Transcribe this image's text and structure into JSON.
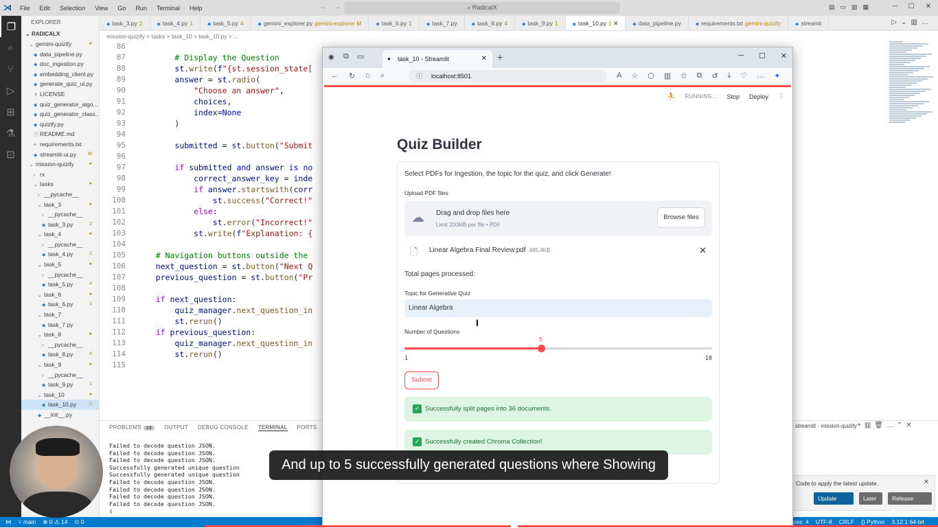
{
  "titlebar": {
    "menu": [
      "File",
      "Edit",
      "Selection",
      "View",
      "Go",
      "Run",
      "Terminal",
      "Help"
    ],
    "command_center": "RadicalX"
  },
  "explorer": {
    "header": "EXPLORER",
    "root": "RADICALX",
    "items": [
      {
        "label": "gemini-quizify",
        "level": 1,
        "type": "folder-open",
        "badge": "●"
      },
      {
        "label": "data_pipeline.py",
        "level": 2,
        "type": "py",
        "badge": ""
      },
      {
        "label": "doc_ingestion.py",
        "level": 2,
        "type": "py",
        "badge": ""
      },
      {
        "label": "embedding_client.py",
        "level": 2,
        "type": "py",
        "badge": ""
      },
      {
        "label": "generate_quiz_ui.py",
        "level": 2,
        "type": "py",
        "badge": ""
      },
      {
        "label": "LICENSE",
        "level": 2,
        "type": "file",
        "badge": ""
      },
      {
        "label": "quiz_generator_algo...",
        "level": 2,
        "type": "py",
        "badge": ""
      },
      {
        "label": "quiz_generator_class...",
        "level": 2,
        "type": "py",
        "badge": ""
      },
      {
        "label": "quizify.py",
        "level": 2,
        "type": "py",
        "badge": ""
      },
      {
        "label": "README.md",
        "level": 2,
        "type": "md",
        "badge": ""
      },
      {
        "label": "requirements.txt",
        "level": 2,
        "type": "txt",
        "badge": ""
      },
      {
        "label": "streamlit-ui.py",
        "level": 2,
        "type": "py",
        "badge": "M"
      },
      {
        "label": "mission-quizify",
        "level": 1,
        "type": "folder-open",
        "badge": "●"
      },
      {
        "label": "rx",
        "level": 2,
        "type": "folder",
        "badge": ""
      },
      {
        "label": "tasks",
        "level": 2,
        "type": "folder-open",
        "badge": "●"
      },
      {
        "label": "__pycache__",
        "level": 3,
        "type": "folder",
        "badge": ""
      },
      {
        "label": "task_3",
        "level": 3,
        "type": "folder-open",
        "badge": "●"
      },
      {
        "label": "__pycache__",
        "level": 4,
        "type": "folder",
        "badge": ""
      },
      {
        "label": "task_3.py",
        "level": 4,
        "type": "py",
        "badge": "2"
      },
      {
        "label": "task_4",
        "level": 3,
        "type": "folder-open",
        "badge": "●"
      },
      {
        "label": "__pycache__",
        "level": 4,
        "type": "folder",
        "badge": ""
      },
      {
        "label": "task_4.py",
        "level": 4,
        "type": "py",
        "badge": "1"
      },
      {
        "label": "task_5",
        "level": 3,
        "type": "folder-open",
        "badge": "●"
      },
      {
        "label": "__pycache__",
        "level": 4,
        "type": "folder",
        "badge": ""
      },
      {
        "label": "task_5.py",
        "level": 4,
        "type": "py",
        "badge": "4"
      },
      {
        "label": "task_6",
        "level": 3,
        "type": "folder-open",
        "badge": "●"
      },
      {
        "label": "task_6.py",
        "level": 4,
        "type": "py",
        "badge": "1"
      },
      {
        "label": "task_7",
        "level": 3,
        "type": "folder-open",
        "badge": ""
      },
      {
        "label": "task_7.py",
        "level": 4,
        "type": "py",
        "badge": ""
      },
      {
        "label": "task_8",
        "level": 3,
        "type": "folder-open",
        "badge": "●"
      },
      {
        "label": "__pycache__",
        "level": 4,
        "type": "folder",
        "badge": ""
      },
      {
        "label": "task_8.py",
        "level": 4,
        "type": "py",
        "badge": "4"
      },
      {
        "label": "task_9",
        "level": 3,
        "type": "folder-open",
        "badge": "●"
      },
      {
        "label": "__pycache__",
        "level": 4,
        "type": "folder",
        "badge": ""
      },
      {
        "label": "task_9.py",
        "level": 4,
        "type": "py",
        "badge": "1"
      },
      {
        "label": "task_10",
        "level": 3,
        "type": "folder-open",
        "badge": "●"
      },
      {
        "label": "task_10.py",
        "level": 4,
        "type": "py",
        "badge": "1",
        "selected": true
      },
      {
        "label": "__init__.py",
        "level": 3,
        "type": "py",
        "badge": ""
      }
    ]
  },
  "tabs": [
    {
      "label": "task_3.py",
      "badge": "2"
    },
    {
      "label": "task_4.py",
      "badge": "1"
    },
    {
      "label": "task_5.py",
      "badge": "4"
    },
    {
      "label": "gemini_explorer.py",
      "badge": "gemini-explorer M"
    },
    {
      "label": "task_6.py",
      "badge": "1"
    },
    {
      "label": "task_7.py",
      "badge": ""
    },
    {
      "label": "task_8.py",
      "badge": "4"
    },
    {
      "label": "task_9.py",
      "badge": "1"
    },
    {
      "label": "task_10.py",
      "badge": "1",
      "active": true
    },
    {
      "label": "data_pipeline.py",
      "badge": ""
    },
    {
      "label": "requirements.txt",
      "badge": "gemini-quizify"
    },
    {
      "label": "streamli",
      "badge": ""
    }
  ],
  "breadcrumb": "mission-quizify > tasks > task_10 > task_10.py > ...",
  "editor": {
    "line_numbers": [
      "86",
      "87",
      "88",
      "89",
      "90",
      "91",
      "92",
      "93",
      "94",
      "95",
      "96",
      "97",
      "98",
      "99",
      "100",
      "101",
      "102",
      "103",
      "104",
      "105",
      "106",
      "107",
      "108",
      "109",
      "110",
      "111",
      "112",
      "113",
      "114",
      "115"
    ]
  },
  "panel": {
    "tabs": [
      "PROBLEMS",
      "OUTPUT",
      "DEBUG CONSOLE",
      "TERMINAL",
      "PORTS"
    ],
    "problems_count": "14",
    "terminal_title": "streamlit - mission-quizify",
    "terminal_lines": [
      "Failed to decode question JSON.",
      "Failed to decode question JSON.",
      "Failed to decode question JSON.",
      "Successfully generated unique question",
      "Successfully generated unique question",
      "Failed to decode question JSON.",
      "Failed to decode question JSON.",
      "Failed to decode question JSON.",
      "Failed to decode question JSON."
    ]
  },
  "notification": {
    "text": "Code to apply the latest update.",
    "update_now": "Update Now",
    "later": "Later",
    "release_notes": "Release Notes"
  },
  "statusbar": {
    "branch": "main",
    "sync": "⊗ 0 ⚠ 14",
    "ports": "0",
    "spaces": "ces: 4",
    "encoding": "UTF-8",
    "eol": "CRLF",
    "language": "Python",
    "interpreter": "3.12.1 64-bit"
  },
  "browser": {
    "tab_title": "task_10 - Streamlit",
    "url": "localhost:8501"
  },
  "streamlit": {
    "status": "RUNNING...",
    "stop": "Stop",
    "deploy": "Deploy",
    "title": "Quiz Builder",
    "intro": "Select PDFs for Ingestion, the topic for the quiz, and click Generate!",
    "upload_label": "Upload PDF files",
    "drop_main": "Drag and drop files here",
    "drop_sub": "Limit 200MB per file • PDF",
    "browse": "Browse files",
    "file_name": "Linear Algebra Final Review.pdf",
    "file_size": "485.4KB",
    "pages_text": "Total pages processed:",
    "topic_label": "Topic for Generative Quiz",
    "topic_value": "Linear Algebra",
    "num_label": "Number of Questions",
    "slider_min": "1",
    "slider_max": "10",
    "slider_value": 5,
    "submit": "Submit",
    "success1": "Successfully split pages into 36 documents.",
    "success2": "Successfully created Chroma Collection!"
  },
  "caption": "And up to 5 successfully generated questions where Showing",
  "colors": {
    "accent": "#ff4b4b",
    "statusbar": "#007acc",
    "success_bg": "#dff5e4"
  }
}
